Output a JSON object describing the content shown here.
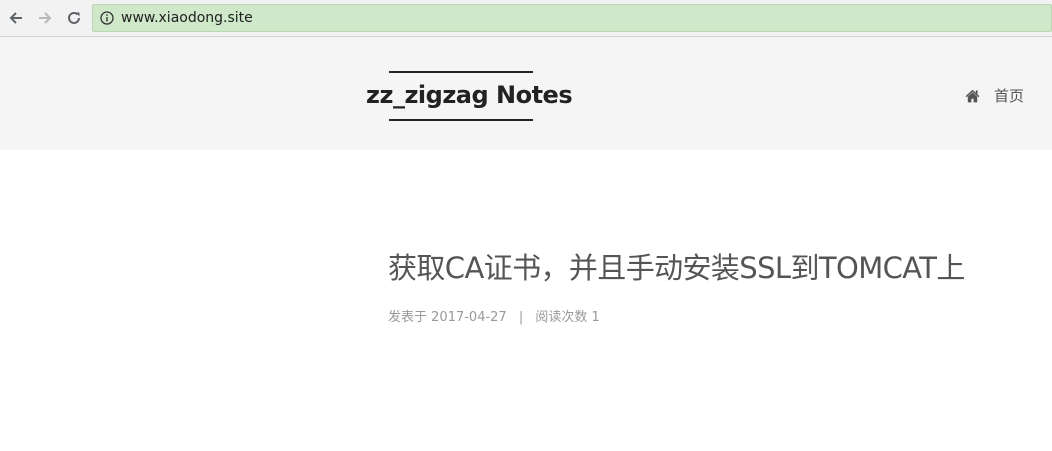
{
  "browser": {
    "url": "www.xiaodong.site",
    "icons": [
      "back-arrow-icon",
      "forward-arrow-icon",
      "reload-icon",
      "info-icon"
    ],
    "colors": {
      "address_bar": "#cfe8c9",
      "chrome": "#f2f2f2"
    }
  },
  "header": {
    "site_title": "zz_zigzag Notes",
    "menu": [
      {
        "icon": "home-icon",
        "label": "首页"
      }
    ],
    "colors": {
      "background": "#f5f5f5",
      "brand_text": "#222222"
    }
  },
  "post": {
    "title": "获取CA证书，并且手动安装SSL到TOMCAT上",
    "meta": {
      "posted_prefix": "发表于",
      "date": "2017-04-27",
      "separator": "|",
      "views_prefix": "阅读次数",
      "views": "1"
    },
    "colors": {
      "title": "#555555",
      "meta": "#999999"
    }
  }
}
